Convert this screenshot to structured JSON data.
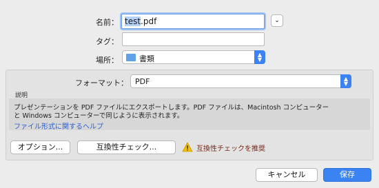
{
  "save_as": {
    "label": "名前：",
    "value": "test.pdf",
    "selected": "test"
  },
  "tags": {
    "label": "タグ：",
    "value": ""
  },
  "where": {
    "label": "場所：",
    "value": "書類"
  },
  "format": {
    "label": "フォーマット：",
    "value": "PDF"
  },
  "description": {
    "heading": "説明",
    "line1": "プレゼンテーションを PDF ファイルにエクスポートします。PDF ファイルは、Macintosh コンピューター",
    "line2": "と Windows コンピューターで同じように表示されます。",
    "help_link": "ファイル形式に関するヘルプ"
  },
  "buttons": {
    "options": "オプション...",
    "compat_check": "互換性チェック...",
    "cancel": "キャンセル",
    "save": "保存"
  },
  "warning": {
    "text": "互換性チェックを推奨",
    "icon": "warning-icon"
  },
  "colors": {
    "accent": "#3b82f3",
    "link": "#2a5fd6",
    "warning": "#e7b400"
  }
}
